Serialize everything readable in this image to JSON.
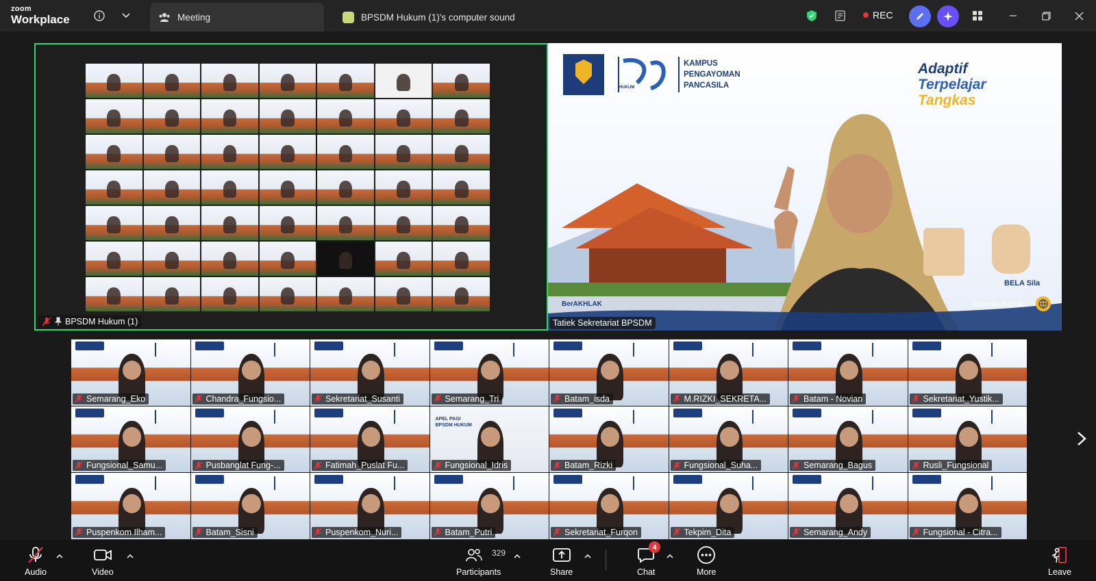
{
  "app": {
    "logo_line1": "zoom",
    "logo_line2": "Workplace"
  },
  "tabs": {
    "meeting": "Meeting",
    "computer_sound": "BPSDM Hukum (1)'s computer sound"
  },
  "status": {
    "rec": "REC"
  },
  "main_left": {
    "name": "BPSDM Hukum (1)"
  },
  "main_right": {
    "name": "Tatiek Sekretariat BPSDM",
    "org_line1": "KAMPUS",
    "org_line2": "PENGAYOMAN",
    "org_line3": "PANCASILA",
    "tag1": "Adaptif",
    "tag2": "Terpelajar",
    "tag3": "Tangkas",
    "footer_left": "BerAKHLAK",
    "footer_url": "kemenkum.go.id",
    "mascot_label": "BELA Sila",
    "logo_text": "HUKUM"
  },
  "gallery": [
    "Semarang_Eko",
    "Chandra_Fungsio...",
    "Sekretariat_Susanti",
    "Semarang_Tri",
    "Batam_isda",
    "M.RIZKI_SEKRETA...",
    "Batam - Novian",
    "Sekretariat_Yustik...",
    "Fungsional_Samu...",
    "Pusbanglat Fung-...",
    "Fatimah_Puslat Fu...",
    "Fungsional_Idris",
    "Batam_Rizki",
    "Fungsional_Suha...",
    "Semarang_Bagus",
    "Rusli_Fungsional",
    "Puspenkom Ilham...",
    "Batam_Sisni",
    "Puspenkom_Nuri...",
    "Batam_Putri",
    "Sekretariat_Furqon",
    "Tekpim_Dita",
    "Semarang_Andy",
    "Fungsional - Citra..."
  ],
  "gallery_special": {
    "apel_line1": "APEL PAGI",
    "apel_line2": "BPSDM HUKUM"
  },
  "toolbar": {
    "audio": "Audio",
    "video": "Video",
    "participants": "Participants",
    "participants_count": "329",
    "share": "Share",
    "chat": "Chat",
    "chat_badge": "4",
    "more": "More",
    "leave": "Leave"
  },
  "colors": {
    "active_speaker": "#2fd86d",
    "rec": "#e0383e",
    "shield": "#2fd86d"
  }
}
